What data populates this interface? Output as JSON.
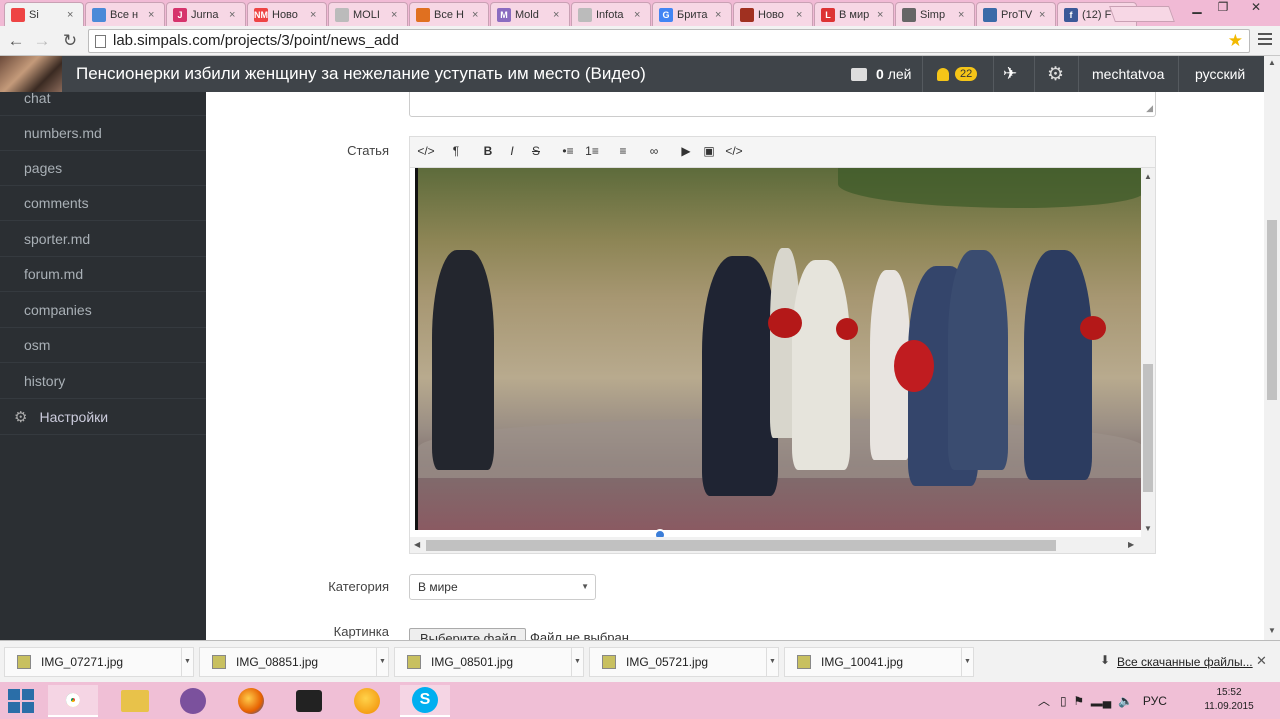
{
  "browser": {
    "tabs": [
      {
        "label": "Si",
        "fav_color": "#e44",
        "fav_text": "",
        "active": true
      },
      {
        "label": "Все н",
        "fav_color": "#4a8ad8",
        "fav_text": ""
      },
      {
        "label": "Jurna",
        "fav_color": "#d6336c",
        "fav_text": "J"
      },
      {
        "label": "Ново",
        "fav_color": "#e44",
        "fav_text": "NM"
      },
      {
        "label": "MOLI",
        "fav_color": "#bbb",
        "fav_text": ""
      },
      {
        "label": "Все Н",
        "fav_color": "#e07020",
        "fav_text": ""
      },
      {
        "label": "Mold",
        "fav_color": "#8a6cc0",
        "fav_text": "M"
      },
      {
        "label": "Infota",
        "fav_color": "#bbb",
        "fav_text": ""
      },
      {
        "label": "Брита",
        "fav_color": "#4285f4",
        "fav_text": "G"
      },
      {
        "label": "Ново",
        "fav_color": "#a03020",
        "fav_text": ""
      },
      {
        "label": "В мир",
        "fav_color": "#d33",
        "fav_text": "L"
      },
      {
        "label": "Simp",
        "fav_color": "#666",
        "fav_text": ""
      },
      {
        "label": "ProTV",
        "fav_color": "#3a6aa8",
        "fav_text": ""
      },
      {
        "label": "(12) F",
        "fav_color": "#3b5998",
        "fav_text": "f"
      }
    ],
    "url": "lab.simpals.com/projects/3/point/news_add"
  },
  "header": {
    "title": "Пенсионерки избили женщину за нежелание уступать им место (Видео)",
    "balance_value": "0",
    "balance_unit": "лей",
    "notifications_count": "22",
    "username": "mechtatvoa",
    "language": "русский"
  },
  "sidebar": {
    "items": [
      "chat",
      "numbers.md",
      "pages",
      "comments",
      "sporter.md",
      "forum.md",
      "companies",
      "osm",
      "history"
    ],
    "settings_label": "Настройки"
  },
  "form": {
    "article_label": "Статья",
    "category_label": "Категория",
    "category_value": "В мире",
    "image_label": "Картинка",
    "file_button": "Выберите файл",
    "file_status": "Файл не выбран",
    "editor_toolbar": [
      "</>",
      "¶",
      "B",
      "I",
      "S",
      "•≡",
      "1≡",
      "≡",
      "∞",
      "▶",
      "▣",
      "</>"
    ],
    "video_progress": 0.33
  },
  "downloads": {
    "files": [
      "IMG_07271.jpg",
      "IMG_08851.jpg",
      "IMG_08501.jpg",
      "IMG_05721.jpg",
      "IMG_10041.jpg"
    ],
    "all_label": "Все скачанные файлы..."
  },
  "taskbar": {
    "lang": "РУС",
    "time": "15:52",
    "date": "11.09.2015"
  },
  "colors": {
    "header_bg": "#3f4449",
    "sidebar_bg": "#2b2f33",
    "badge": "#f5c518",
    "taskbar_bg": "#f0bfd6"
  }
}
